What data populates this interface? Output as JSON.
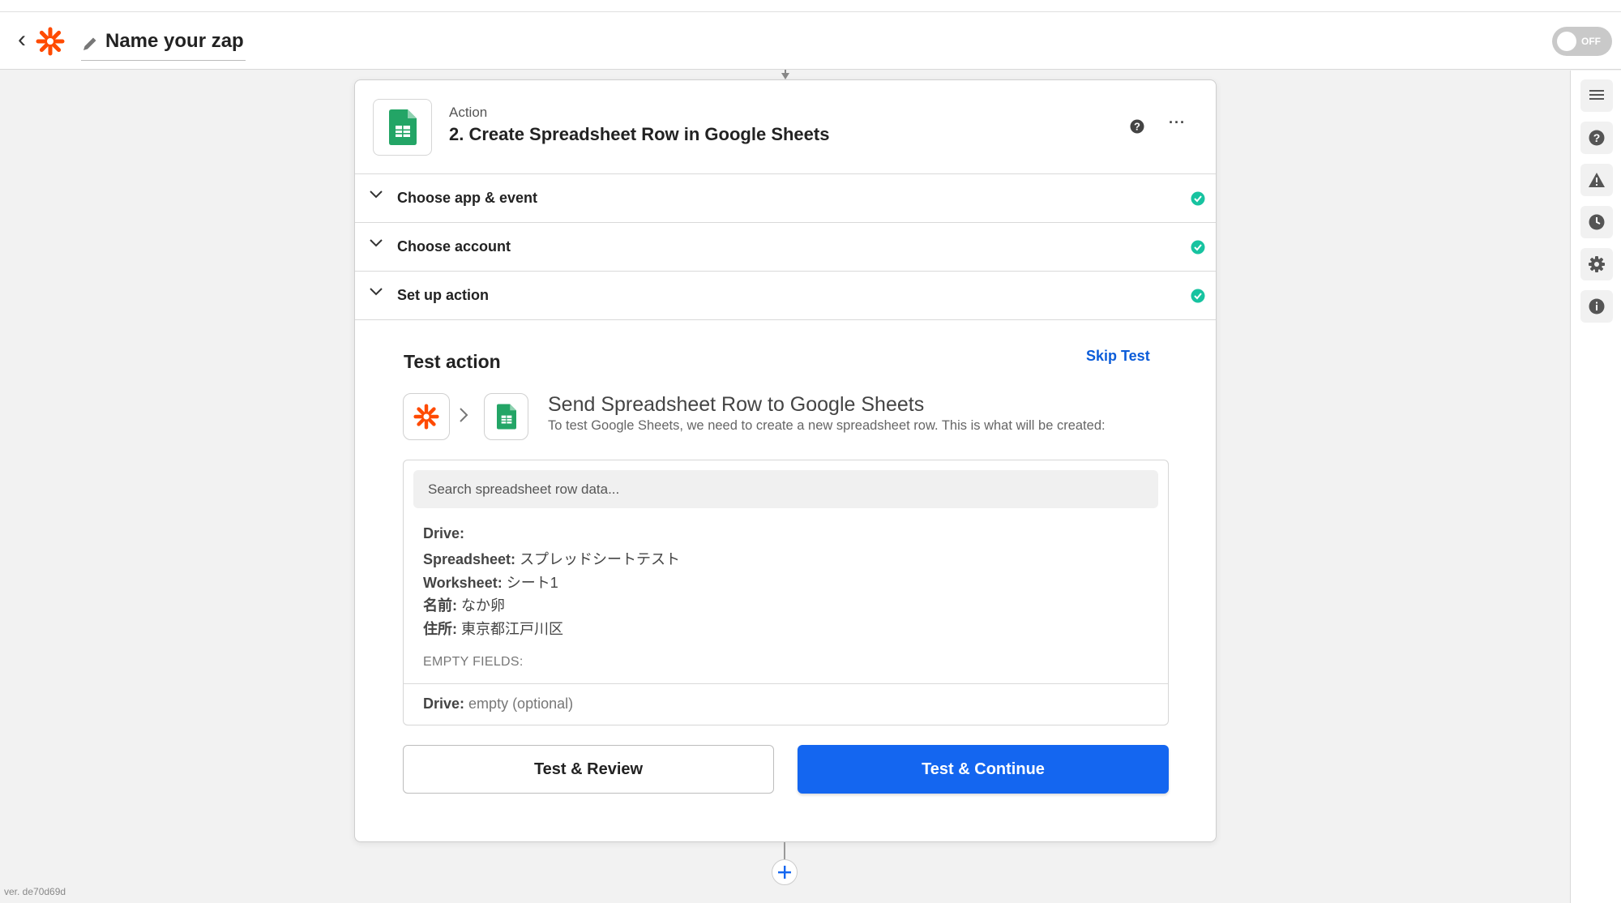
{
  "header": {
    "back_label": "‹",
    "zap_name": "Name your zap",
    "toggle_label": "OFF"
  },
  "step": {
    "type": "Action",
    "title": "2. Create Spreadsheet Row in Google Sheets",
    "more_label": "···"
  },
  "sections": [
    {
      "label": "Choose app & event"
    },
    {
      "label": "Choose account"
    },
    {
      "label": "Set up action"
    }
  ],
  "test": {
    "title": "Test action",
    "skip_label": "Skip Test",
    "send_title": "Send Spreadsheet Row to Google Sheets",
    "send_desc": "To test Google Sheets, we need to create a new spreadsheet row. This is what will be created:",
    "search_placeholder": "Search spreadsheet row data...",
    "fields": [
      {
        "key": "Drive:",
        "value": ""
      },
      {
        "key": "Spreadsheet:",
        "value": "スプレッドシートテスト"
      },
      {
        "key": "Worksheet:",
        "value": "シート1"
      },
      {
        "key": "名前:",
        "value": "なか卵"
      },
      {
        "key": "住所:",
        "value": "東京都江戸川区"
      }
    ],
    "empty_heading": "EMPTY FIELDS:",
    "empty_fields": [
      {
        "key": "Drive:",
        "value": "empty (optional)"
      }
    ]
  },
  "buttons": {
    "review": "Test & Review",
    "continue": "Test & Continue"
  },
  "version": "ver. de70d69d",
  "colors": {
    "accent": "#1466f0",
    "zapier_orange": "#ff4a00",
    "sheets_green": "#23a566",
    "check_green": "#17c3a0"
  }
}
